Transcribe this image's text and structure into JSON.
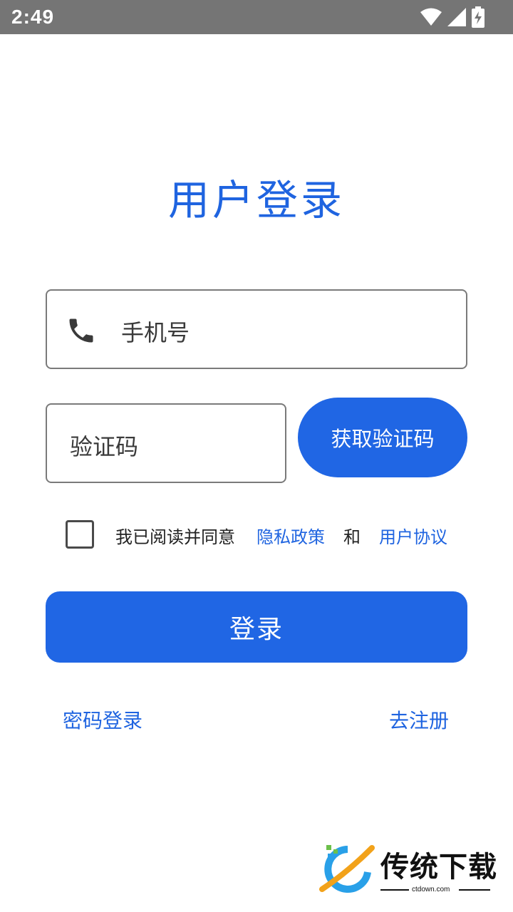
{
  "status_bar": {
    "time": "2:49"
  },
  "title": "用户登录",
  "phone_field": {
    "placeholder": "手机号",
    "icon": "phone-icon"
  },
  "code_field": {
    "placeholder": "验证码"
  },
  "get_code_button": "获取验证码",
  "agreement": {
    "checked": false,
    "prefix": "我已阅读并同意",
    "privacy_link": "隐私政策",
    "and": "和",
    "terms_link": "用户协议"
  },
  "login_button": "登录",
  "links": {
    "password_login": "密码登录",
    "register": "去注册"
  },
  "watermark": {
    "name": "传统下载",
    "url": "ctdown.com"
  },
  "colors": {
    "accent": "#2066e4",
    "status_bar": "#757575"
  }
}
